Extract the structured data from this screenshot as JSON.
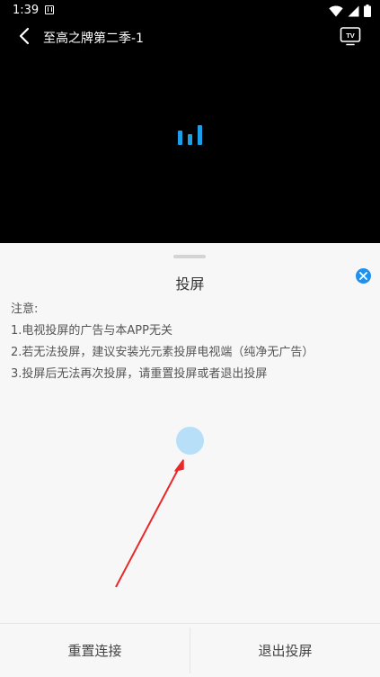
{
  "status_bar": {
    "time": "1:39"
  },
  "player": {
    "title": "至高之牌第二季-1",
    "loading_color": "#1a9fe8"
  },
  "cast_sheet": {
    "title": "投屏",
    "notice_heading": "注意:",
    "notice_items": [
      "1.电视投屏的广告与本APP无关",
      "2.若无法投屏，建议安装光元素投屏电视端（纯净无广告）",
      "3.投屏后无法再次投屏，请重置投屏或者退出投屏"
    ],
    "reset_button": "重置连接",
    "exit_button": "退出投屏",
    "accent_color": "#1e90f0"
  }
}
